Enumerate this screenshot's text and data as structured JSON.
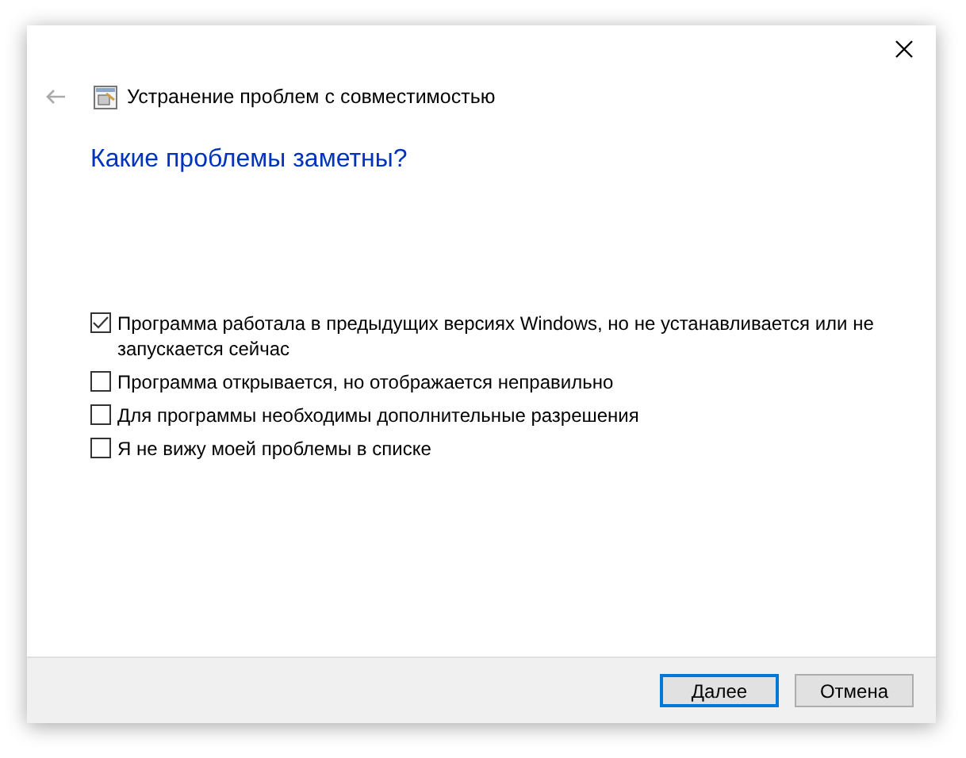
{
  "window": {
    "title": "Устранение проблем с совместимостью"
  },
  "back": {
    "disabled": true
  },
  "heading": "Какие проблемы заметны?",
  "options": [
    {
      "label": "Программа работала в предыдущих версиях Windows, но не устанавливается или не запускается сейчас",
      "checked": true
    },
    {
      "label": "Программа открывается, но отображается неправильно",
      "checked": false
    },
    {
      "label": "Для программы необходимы дополнительные разрешения",
      "checked": false
    },
    {
      "label": "Я не вижу моей проблемы в списке",
      "checked": false
    }
  ],
  "buttons": [
    {
      "label": "Далее",
      "default": true
    },
    {
      "label": "Отмена",
      "default": false
    }
  ]
}
